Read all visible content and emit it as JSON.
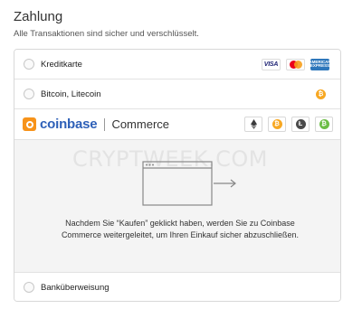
{
  "heading": "Zahlung",
  "subheading": "Alle Transaktionen sind sicher und verschlüsselt.",
  "methods": {
    "card": {
      "label": "Kreditkarte",
      "brands": {
        "visa": "VISA",
        "amex": "AMERICAN EXPRESS"
      },
      "icons": [
        "visa-icon",
        "mastercard-icon",
        "amex-icon"
      ]
    },
    "crypto": {
      "label": "Bitcoin, Litecoin",
      "icon": "bitcoin-icon"
    },
    "coinbase": {
      "logo_text": "coinbase",
      "product": "Commerce",
      "coins": [
        "ethereum-icon",
        "bitcoin-icon",
        "litecoin-icon",
        "bitcoin-cash-icon"
      ],
      "watermark": "CRYPTWEEK.COM",
      "description": "Nachdem Sie “Kaufen” geklickt haben, werden Sie zu Coinbase Commerce weitergeleitet, um Ihren Einkauf sicher abzuschließen."
    },
    "bank": {
      "label": "Banküberweisung"
    }
  },
  "colors": {
    "coinbase_blue": "#2e60b8",
    "coinbase_orange": "#f7931a",
    "bitcoin": "#f7a823",
    "litecoin": "#4a4a4a",
    "bitcoin_cash": "#6cbd45"
  }
}
